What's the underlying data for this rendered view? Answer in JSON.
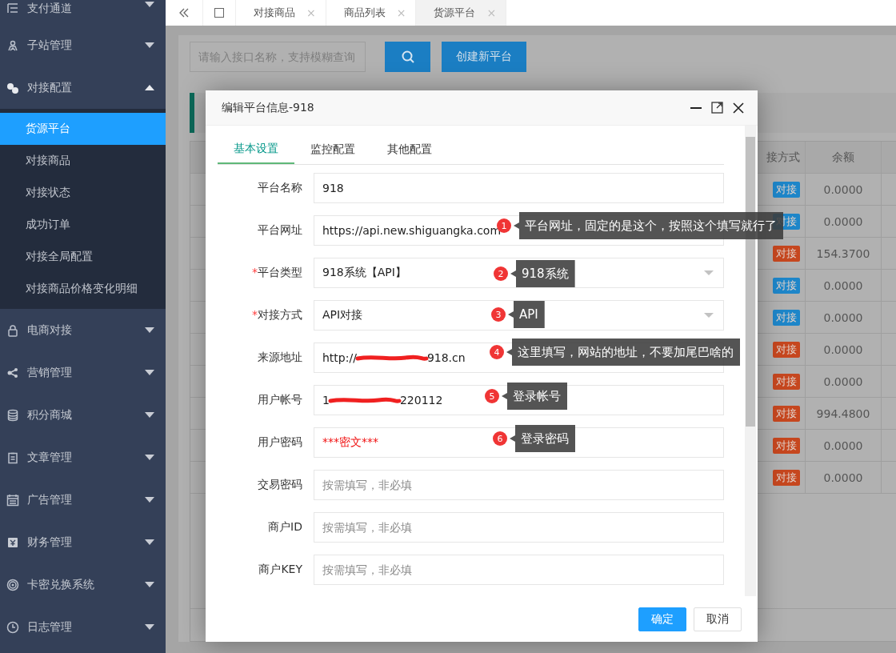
{
  "sidebar": {
    "items": [
      {
        "label": "支付通道",
        "expanded": false
      },
      {
        "label": "子站管理",
        "expanded": false
      },
      {
        "label": "对接配置",
        "expanded": true,
        "children": [
          {
            "label": "货源平台",
            "selected": true
          },
          {
            "label": "对接商品",
            "selected": false
          },
          {
            "label": "对接状态",
            "selected": false
          },
          {
            "label": "成功订单",
            "selected": false
          },
          {
            "label": "对接全局配置",
            "selected": false
          },
          {
            "label": "对接商品价格变化明细",
            "selected": false
          }
        ]
      },
      {
        "label": "电商对接",
        "expanded": false
      },
      {
        "label": "营销管理",
        "expanded": false
      },
      {
        "label": "积分商城",
        "expanded": false
      },
      {
        "label": "文章管理",
        "expanded": false
      },
      {
        "label": "广告管理",
        "expanded": false
      },
      {
        "label": "财务管理",
        "expanded": false
      },
      {
        "label": "卡密兑换系统",
        "expanded": false
      },
      {
        "label": "日志管理",
        "expanded": false
      }
    ]
  },
  "tab_bar": {
    "tabs": [
      {
        "label": "对接商品",
        "close": "×",
        "selected": false
      },
      {
        "label": "商品列表",
        "close": "×",
        "selected": false
      },
      {
        "label": "货源平台",
        "close": "×",
        "selected": true
      }
    ]
  },
  "toolbar": {
    "search": {
      "placeholder": "请输入接口名称，支持模糊查询"
    },
    "create_button": "创建新平台"
  },
  "table": {
    "columns": [
      "接方式",
      "余额"
    ],
    "rows": [
      {
        "method": "对接",
        "color": "#1e86c9",
        "balance": "0.0000"
      },
      {
        "method": "对接",
        "color": "#1e86c9",
        "balance": "0.0000"
      },
      {
        "method": "对接",
        "color": "#c6471f",
        "balance": "154.3700"
      },
      {
        "method": "对接",
        "color": "#1e86c9",
        "balance": "0.0000"
      },
      {
        "method": "对接",
        "color": "#1e86c9",
        "balance": "0.0000"
      },
      {
        "method": "对接",
        "color": "#c6471f",
        "balance": "0.0000"
      },
      {
        "method": "对接",
        "color": "#c6471f",
        "balance": "0.0000"
      },
      {
        "method": "对接",
        "color": "#c6471f",
        "balance": "994.4800"
      },
      {
        "method": "对接",
        "color": "#c6471f",
        "balance": "0.0000"
      },
      {
        "method": "对接",
        "color": "#c6471f",
        "balance": "0.0000"
      }
    ]
  },
  "dialog": {
    "title": "编辑平台信息-918",
    "tabs": [
      {
        "label": "基本设置",
        "selected": true
      },
      {
        "label": "监控配置",
        "selected": false
      },
      {
        "label": "其他配置",
        "selected": false
      }
    ],
    "fields": [
      {
        "label": "平台名称",
        "kind": "text",
        "value": "918"
      },
      {
        "label": "平台网址",
        "kind": "text",
        "value": "https://api.new.shiguangka.com"
      },
      {
        "label": "平台类型",
        "required_mark": "*",
        "kind": "select",
        "value": "918系统【API】"
      },
      {
        "label": "对接方式",
        "required_mark": "*",
        "kind": "select",
        "value": "API对接"
      },
      {
        "label": "来源地址",
        "kind": "redacted",
        "value_start": "http://",
        "value_end": "918.cn"
      },
      {
        "label": "用户帐号",
        "kind": "redacted",
        "value_start": "1",
        "value_end": "220112"
      },
      {
        "label": "用户密码",
        "kind": "secret",
        "value": "***密文***"
      },
      {
        "label": "交易密码",
        "kind": "text",
        "placeholder": "按需填写，非必填"
      },
      {
        "label": "商户ID",
        "kind": "text",
        "placeholder": "按需填写，非必填"
      },
      {
        "label": "商户KEY",
        "kind": "text",
        "placeholder": "按需填写，非必填"
      }
    ],
    "buttons": [
      {
        "label": "确定",
        "primary": true
      },
      {
        "label": "取消",
        "primary": false
      }
    ]
  },
  "annotations": [
    {
      "number": "1",
      "text": "平台网址，固定的是这个，按照这个填写就行了"
    },
    {
      "number": "2",
      "text": "918系统"
    },
    {
      "number": "3",
      "text": "API"
    },
    {
      "number": "4",
      "text": "这里填写，网站的地址，不要加尾巴啥的"
    },
    {
      "number": "5",
      "text": "登录帐号"
    },
    {
      "number": "6",
      "text": "登录密码"
    }
  ]
}
